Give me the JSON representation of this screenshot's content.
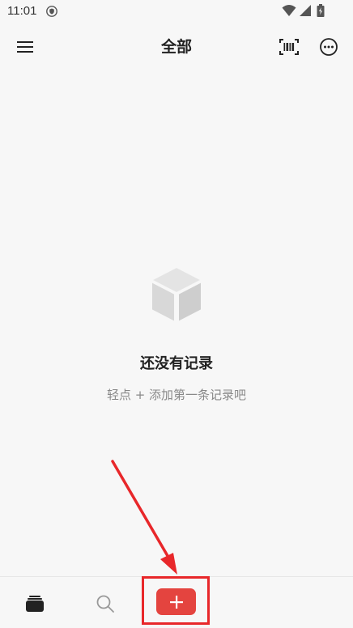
{
  "status_bar": {
    "time": "11:01"
  },
  "header": {
    "title": "全部"
  },
  "empty_state": {
    "title": "还没有记录",
    "hint": "轻点 + 添加第一条记录吧"
  },
  "icons": {
    "menu": "hamburger-menu-icon",
    "scan": "barcode-scan-icon",
    "more": "more-options-icon",
    "empty": "cube-icon",
    "records": "stack-icon",
    "search": "search-icon",
    "add": "plus-icon"
  },
  "colors": {
    "accent": "#e4443f",
    "annotation": "#e8272a",
    "background": "#f7f7f7"
  }
}
